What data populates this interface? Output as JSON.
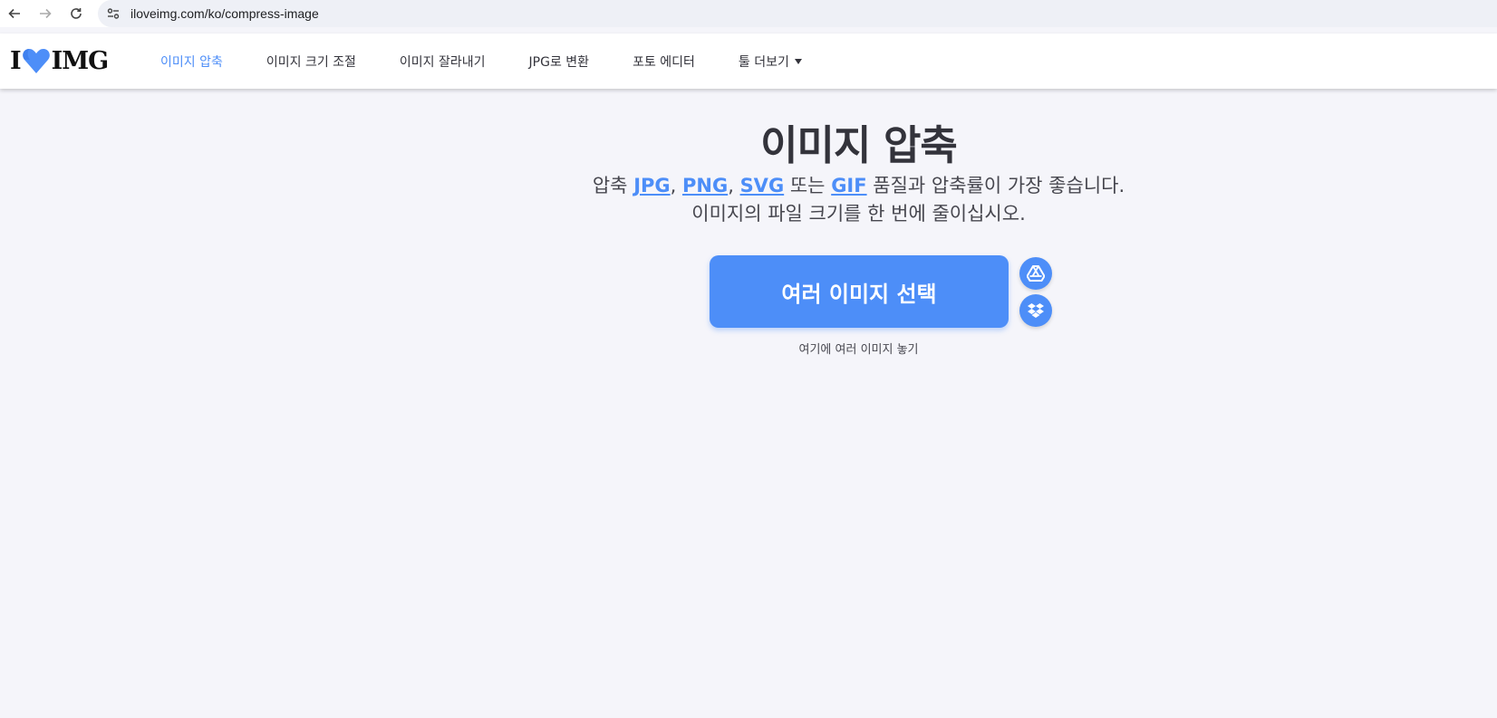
{
  "browser": {
    "url": "iloveimg.com/ko/compress-image"
  },
  "logo": {
    "left": "I",
    "right": "IMG",
    "heart_color": "#4d8ef8"
  },
  "menu": {
    "items": [
      {
        "label": "이미지 압축",
        "active": true
      },
      {
        "label": "이미지 크기 조절"
      },
      {
        "label": "이미지 잘라내기"
      },
      {
        "label": "JPG로 변환"
      },
      {
        "label": "포토 에디터"
      },
      {
        "label": "툴 더보기",
        "dropdown": true
      }
    ]
  },
  "main": {
    "title": "이미지 압축",
    "subtitle": {
      "prefix": "압축",
      "formats": [
        "JPG",
        "PNG",
        "SVG",
        "GIF"
      ],
      "sep1": ", ",
      "sep2": ", ",
      "or": " 또는 ",
      "suffix": " 품질과 압축률이 가장 좋습니다.",
      "line2": "이미지의 파일 크기를 한 번에 줄이십시오."
    },
    "select_button": "여러 이미지 선택",
    "drop_text": "여기에 여러 이미지 놓기",
    "cloud_icons": [
      "google-drive-icon",
      "dropbox-icon"
    ]
  },
  "colors": {
    "accent": "#4d8ef8",
    "background": "#f5f5fa",
    "text": "#33333b"
  }
}
